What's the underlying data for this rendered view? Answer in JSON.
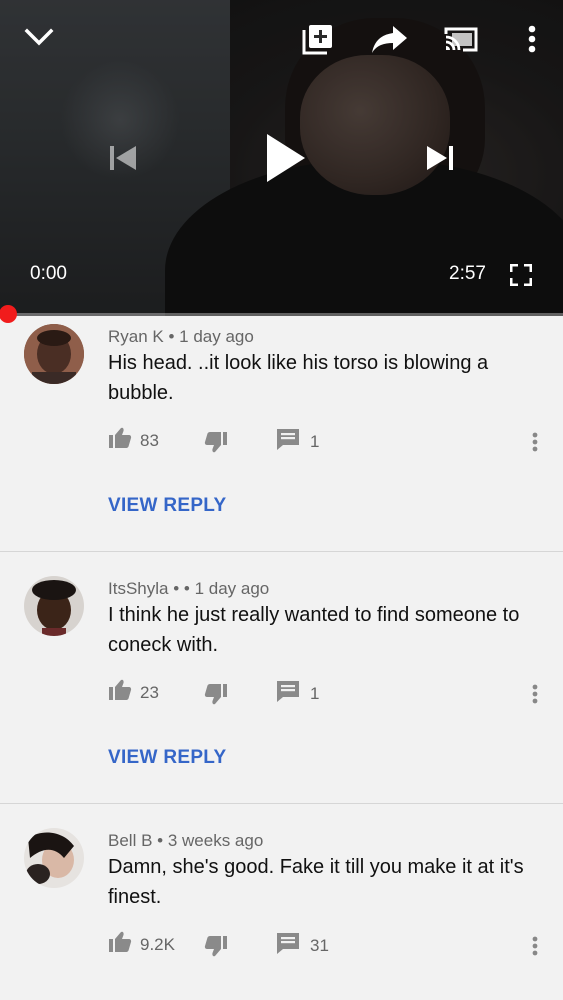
{
  "player": {
    "current_time": "0:00",
    "duration": "2:57",
    "progress_fraction": 0.0
  },
  "comments": [
    {
      "author": "Ryan K",
      "separator": "•",
      "time": "1 day ago",
      "text": "His head. ..it look like his torso is blowing a bubble.",
      "likes": "83",
      "replies": "1",
      "view_reply": "VIEW REPLY"
    },
    {
      "author": "ItsShyla •",
      "separator": "•",
      "time": "1 day ago",
      "text": "I think he just really wanted to find someone to coneck with.",
      "likes": "23",
      "replies": "1",
      "view_reply": "VIEW REPLY"
    },
    {
      "author": "Bell B",
      "separator": "•",
      "time": "3 weeks ago",
      "text": "Damn, she's good. Fake it till you make it at it's finest.",
      "likes": "9.2K",
      "replies": "31"
    }
  ],
  "colors": {
    "accent_red": "#ff0000",
    "link_blue": "#3566c8",
    "background": "#f2f2f2"
  },
  "icons": {
    "player": [
      "chevron-down-icon",
      "add-to-playlist-icon",
      "share-icon",
      "cast-icon",
      "more-vert-icon",
      "skip-previous-icon",
      "play-icon",
      "skip-next-icon",
      "fullscreen-icon"
    ],
    "comment": [
      "thumb-up-icon",
      "thumb-down-icon",
      "reply-icon",
      "more-vert-icon"
    ]
  }
}
